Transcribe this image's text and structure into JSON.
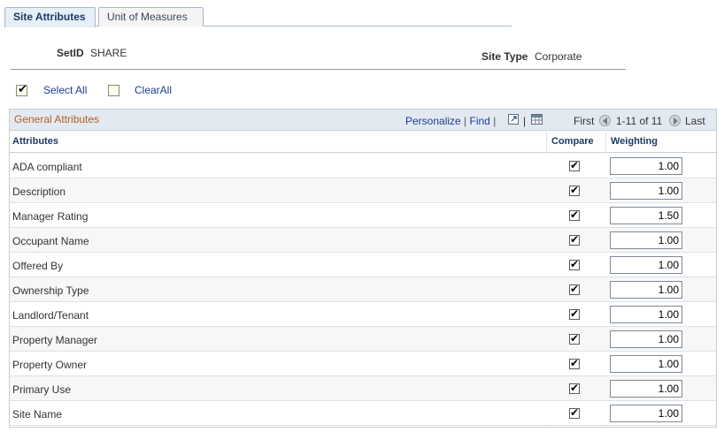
{
  "tabs": [
    {
      "label": "Site Attributes",
      "active": true
    },
    {
      "label": "Unit of Measures",
      "active": false
    }
  ],
  "header": {
    "setid_label": "SetID",
    "setid_value": "SHARE",
    "sitetype_label": "Site Type",
    "sitetype_value": "Corporate"
  },
  "actions": {
    "select_all": "Select All",
    "clear_all": "ClearAll"
  },
  "grid": {
    "title": "General Attributes",
    "personalize": "Personalize",
    "find": "Find",
    "first": "First",
    "range": "1-11 of 11",
    "last": "Last",
    "columns": {
      "attributes": "Attributes",
      "compare": "Compare",
      "weighting": "Weighting"
    },
    "rows": [
      {
        "attribute": "ADA compliant",
        "compare": true,
        "weighting": "1.00"
      },
      {
        "attribute": "Description",
        "compare": true,
        "weighting": "1.00"
      },
      {
        "attribute": "Manager Rating",
        "compare": true,
        "weighting": "1.50"
      },
      {
        "attribute": "Occupant Name",
        "compare": true,
        "weighting": "1.00"
      },
      {
        "attribute": "Offered By",
        "compare": true,
        "weighting": "1.00"
      },
      {
        "attribute": "Ownership Type",
        "compare": true,
        "weighting": "1.00"
      },
      {
        "attribute": "Landlord/Tenant",
        "compare": true,
        "weighting": "1.00"
      },
      {
        "attribute": "Property Manager",
        "compare": true,
        "weighting": "1.00"
      },
      {
        "attribute": "Property Owner",
        "compare": true,
        "weighting": "1.00"
      },
      {
        "attribute": "Primary Use",
        "compare": true,
        "weighting": "1.00"
      },
      {
        "attribute": "Site Name",
        "compare": true,
        "weighting": "1.00"
      }
    ]
  },
  "icons": {
    "select_all": "checked-box-icon",
    "clear_all": "empty-box-icon",
    "view_all": "new-window-icon",
    "download": "spreadsheet-icon",
    "prev": "previous-arrow-icon",
    "next": "next-arrow-icon"
  },
  "colors": {
    "tab_active_bg": "#e6eef7",
    "grid_header_bg": "#e3e9f1",
    "grid_title": "#b35f24",
    "link": "#1a3e8f"
  }
}
